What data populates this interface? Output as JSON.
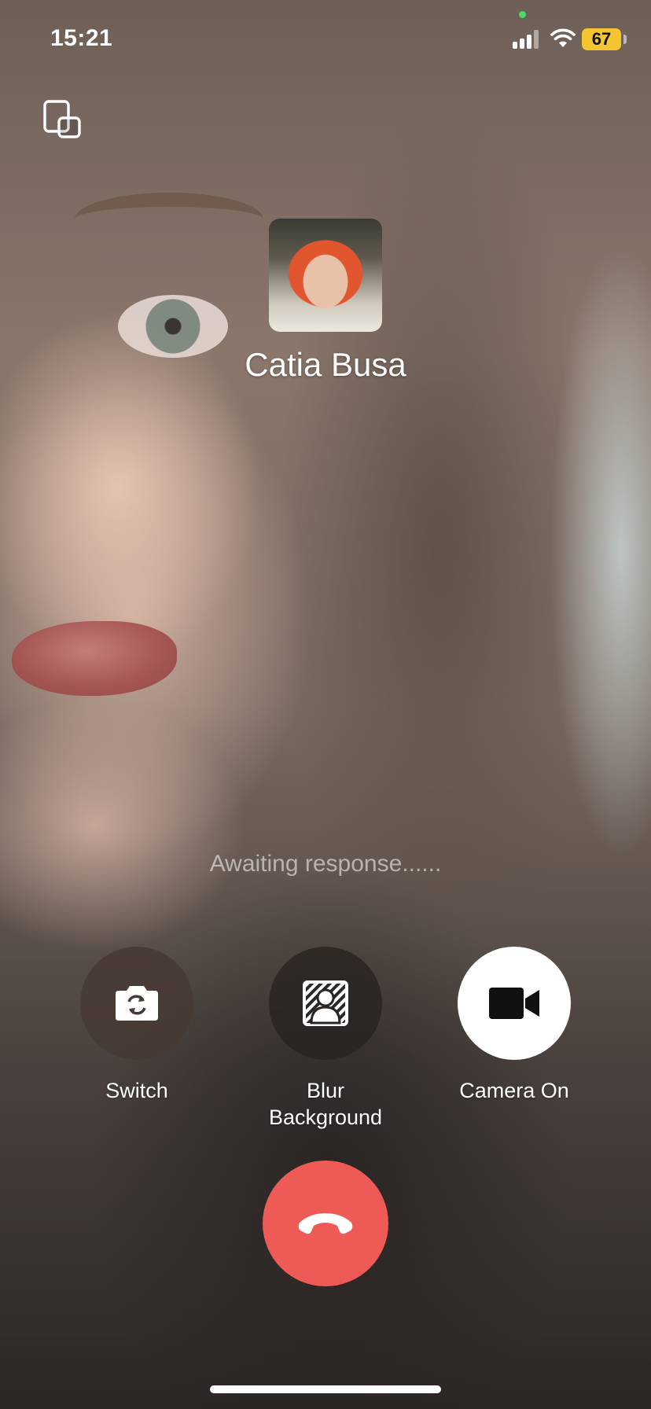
{
  "status_bar": {
    "time": "15:21",
    "battery_level": "67",
    "icons": [
      "signal-icon",
      "wifi-icon",
      "battery-icon"
    ]
  },
  "top_controls": {
    "pip_icon": "picture-in-picture-icon"
  },
  "callee": {
    "name": "Catia Busa"
  },
  "call_status": "Awaiting response......",
  "controls": {
    "switch": {
      "label": "Switch",
      "icon": "switch-camera-icon"
    },
    "blur": {
      "label_line1": "Blur",
      "label_line2": "Background",
      "icon": "blur-background-icon"
    },
    "camera": {
      "label": "Camera On",
      "icon": "video-camera-icon"
    }
  },
  "end_call": {
    "icon": "end-call-icon"
  },
  "colors": {
    "end_call": "#ee5a56",
    "battery": "#f4c431",
    "camera_button": "#ffffff"
  }
}
